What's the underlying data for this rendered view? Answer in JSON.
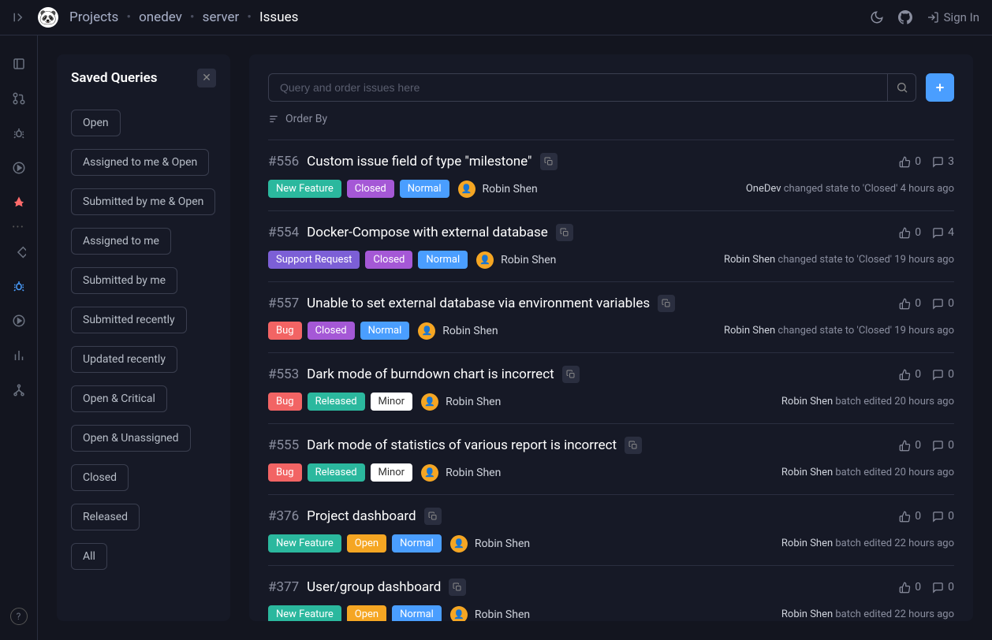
{
  "breadcrumbs": [
    "Projects",
    "onedev",
    "server",
    "Issues"
  ],
  "sign_in_label": "Sign In",
  "saved_queries": {
    "title": "Saved Queries",
    "items": [
      "Open",
      "Assigned to me & Open",
      "Submitted by me & Open",
      "Assigned to me",
      "Submitted by me",
      "Submitted recently",
      "Updated recently",
      "Open & Critical",
      "Open & Unassigned",
      "Closed",
      "Released",
      "All"
    ]
  },
  "search": {
    "placeholder": "Query and order issues here"
  },
  "order_by_label": "Order By",
  "tag_labels": {
    "new-feature": "New Feature",
    "closed": "Closed",
    "normal": "Normal",
    "support-request": "Support Request",
    "bug": "Bug",
    "released": "Released",
    "minor": "Minor",
    "open": "Open"
  },
  "issues": [
    {
      "number": "#556",
      "title": "Custom issue field of type \"milestone\"",
      "votes": 0,
      "comments": 3,
      "tags": [
        "new-feature",
        "closed",
        "normal"
      ],
      "user": "Robin Shen",
      "actor": "OneDev",
      "activity": "changed state to 'Closed' 4 hours ago"
    },
    {
      "number": "#554",
      "title": "Docker-Compose with external database",
      "votes": 0,
      "comments": 4,
      "tags": [
        "support-request",
        "closed",
        "normal"
      ],
      "user": "Robin Shen",
      "actor": "Robin Shen",
      "activity": "changed state to 'Closed' 19 hours ago"
    },
    {
      "number": "#557",
      "title": "Unable to set external database via environment variables",
      "votes": 0,
      "comments": 0,
      "tags": [
        "bug",
        "closed",
        "normal"
      ],
      "user": "Robin Shen",
      "actor": "Robin Shen",
      "activity": "changed state to 'Closed' 19 hours ago"
    },
    {
      "number": "#553",
      "title": "Dark mode of burndown chart is incorrect",
      "votes": 0,
      "comments": 0,
      "tags": [
        "bug",
        "released",
        "minor"
      ],
      "user": "Robin Shen",
      "actor": "Robin Shen",
      "activity": "batch edited 20 hours ago"
    },
    {
      "number": "#555",
      "title": "Dark mode of statistics of various report is incorrect",
      "votes": 0,
      "comments": 0,
      "tags": [
        "bug",
        "released",
        "minor"
      ],
      "user": "Robin Shen",
      "actor": "Robin Shen",
      "activity": "batch edited 20 hours ago"
    },
    {
      "number": "#376",
      "title": "Project dashboard",
      "votes": 0,
      "comments": 0,
      "tags": [
        "new-feature",
        "open",
        "normal"
      ],
      "user": "Robin Shen",
      "actor": "Robin Shen",
      "activity": "batch edited 22 hours ago"
    },
    {
      "number": "#377",
      "title": "User/group dashboard",
      "votes": 0,
      "comments": 0,
      "tags": [
        "new-feature",
        "open",
        "normal"
      ],
      "user": "Robin Shen",
      "actor": "Robin Shen",
      "activity": "batch edited 22 hours ago"
    }
  ]
}
